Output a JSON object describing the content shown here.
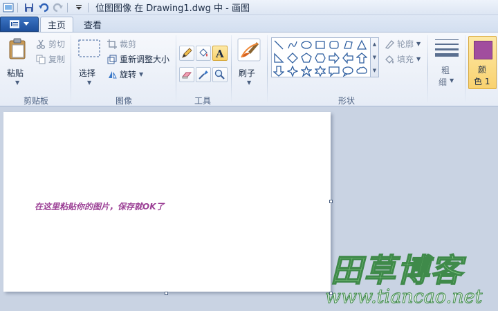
{
  "window": {
    "title": "位图图像 在 Drawing1.dwg 中 - 画图"
  },
  "qat": {
    "icons": [
      "save-icon",
      "undo-icon",
      "redo-icon",
      "customize-dropdown-icon"
    ]
  },
  "tabs": [
    {
      "label": "主页",
      "active": true
    },
    {
      "label": "查看",
      "active": false
    }
  ],
  "ribbon": {
    "clipboard": {
      "label": "剪贴板",
      "paste": "粘贴",
      "cut": "剪切",
      "copy": "复制"
    },
    "image": {
      "label": "图像",
      "select": "选择",
      "crop": "裁剪",
      "resize": "重新调整大小",
      "rotate": "旋转"
    },
    "tools": {
      "label": "工具"
    },
    "brushes": {
      "label": "刷子"
    },
    "shapes": {
      "label": "形状",
      "outline": "轮廓",
      "fill": "填充"
    },
    "size": {
      "label_line1": "粗",
      "label_line2": "细"
    },
    "color1": {
      "label_line1": "颜",
      "label_line2": "色 1",
      "color": "#a14d9e"
    }
  },
  "canvas": {
    "text": "在这里粘贴你的图片，保存就OK了",
    "text_color": "#9b3f95"
  },
  "watermark": {
    "title": "田草博客",
    "url": "www.tiancao.net"
  },
  "colors": {
    "accent": "#1d4f9c",
    "ribbon_bg": "#e6ecf6",
    "workarea_bg": "#c9d3e3"
  }
}
